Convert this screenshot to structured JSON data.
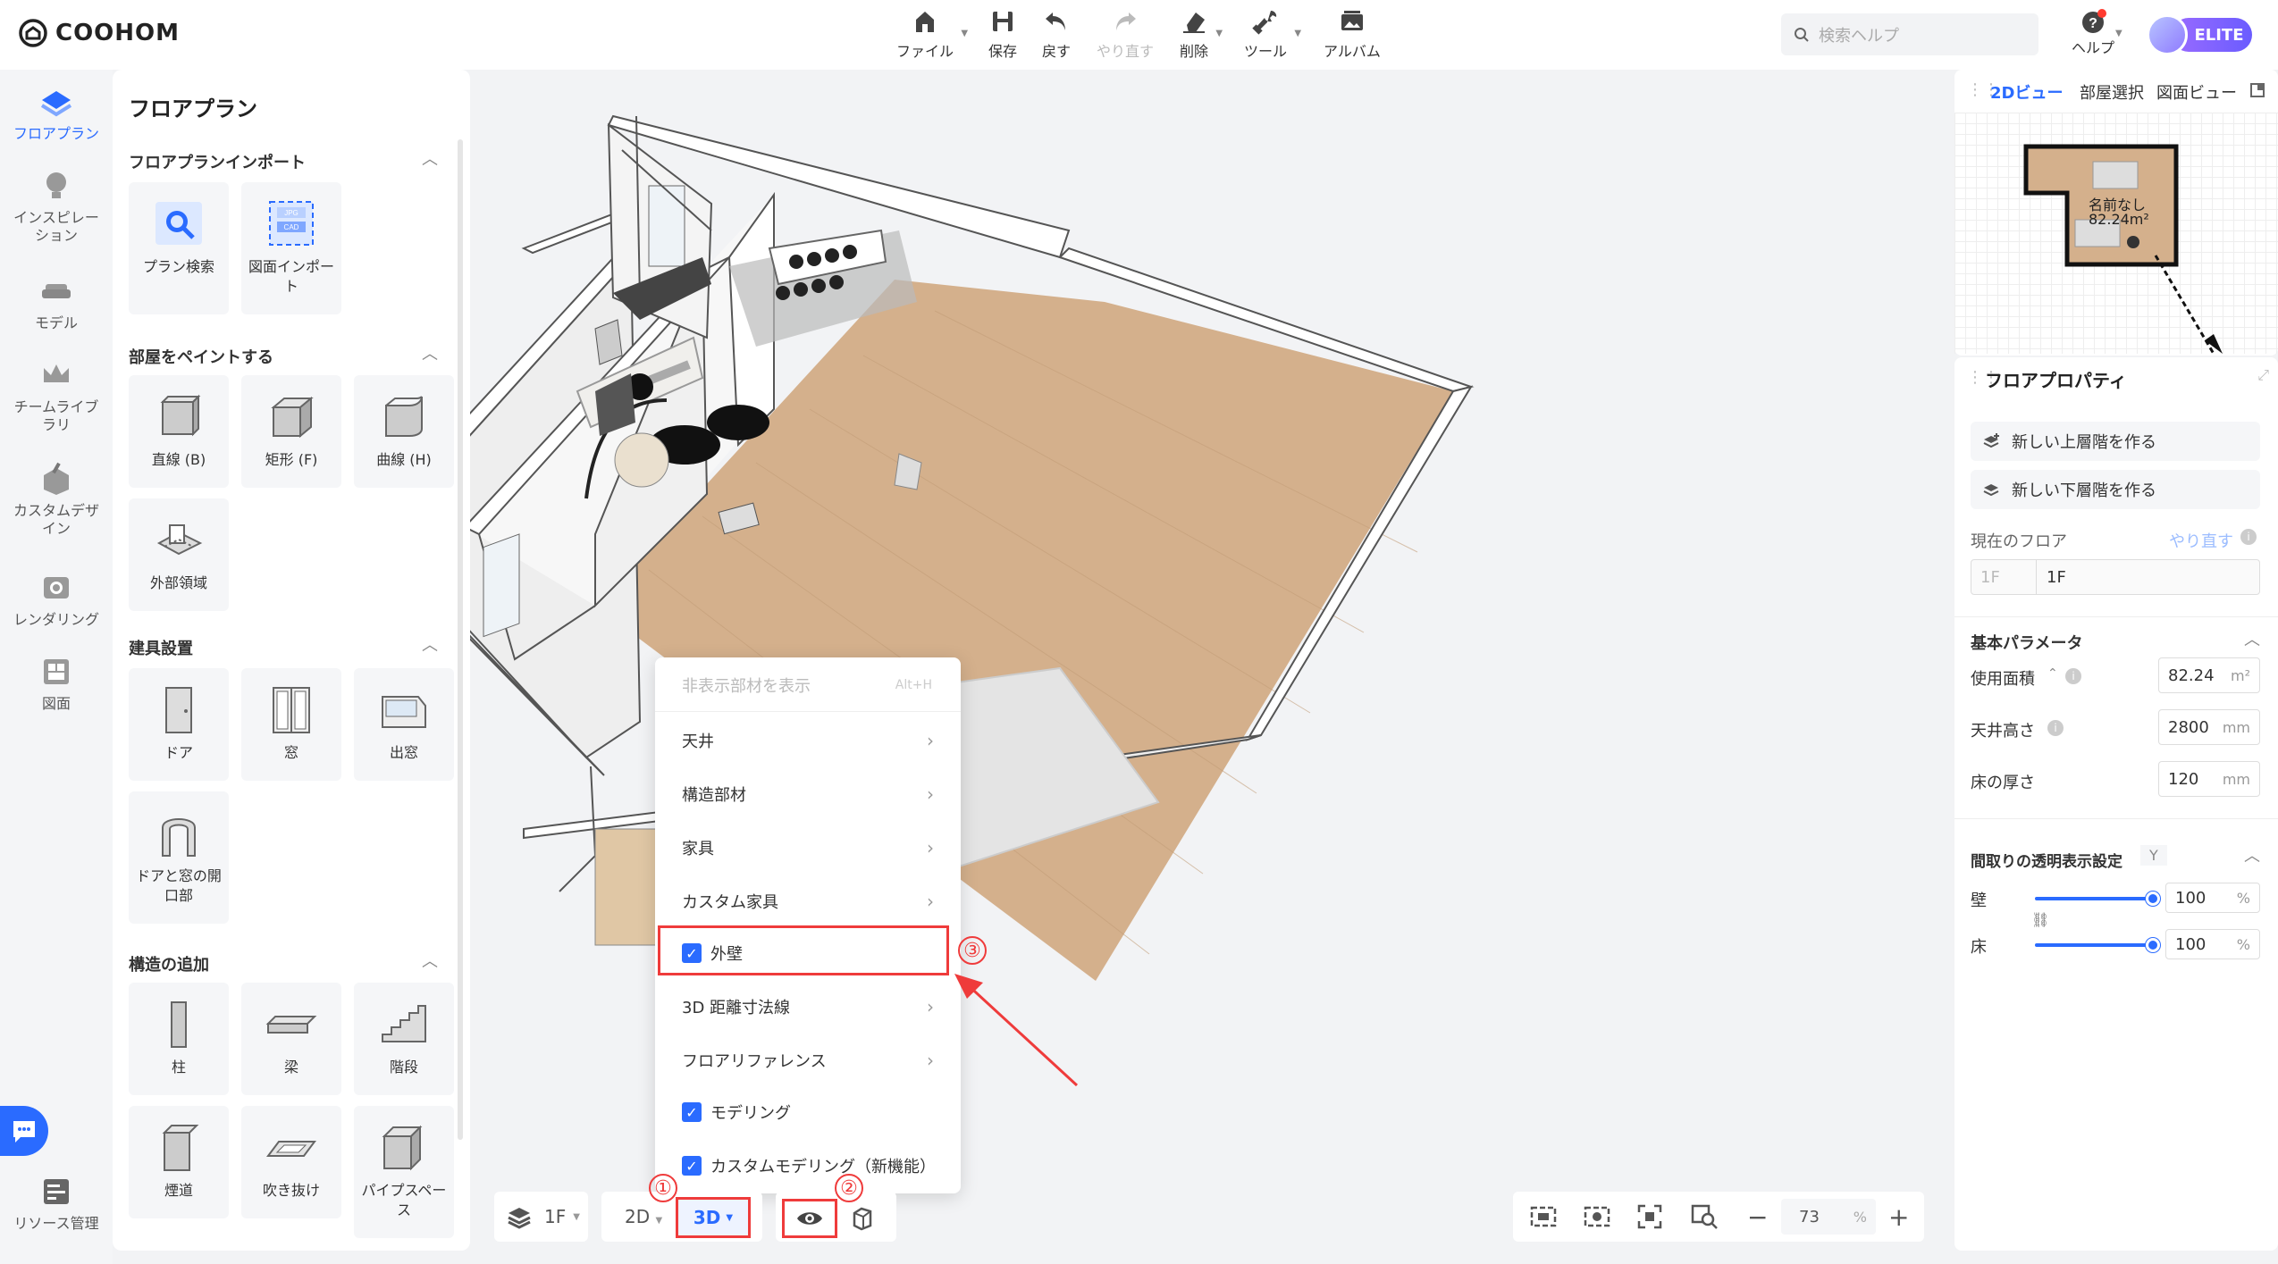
{
  "brand": {
    "name": "COOHOM"
  },
  "toolbar": {
    "file": "ファイル",
    "save": "保存",
    "undo": "戻す",
    "redo": "やり直す",
    "delete": "削除",
    "tools": "ツール",
    "album": "アルバム"
  },
  "search": {
    "placeholder": "検索ヘルプ"
  },
  "help": {
    "label": "ヘルプ"
  },
  "badge": {
    "label": "ELITE"
  },
  "nav": {
    "items": [
      {
        "label": "フロアプラン"
      },
      {
        "label": "インスピレーション"
      },
      {
        "label": "モデル"
      },
      {
        "label": "チームライブラリ"
      },
      {
        "label": "カスタムデザイン"
      },
      {
        "label": "レンダリング"
      },
      {
        "label": "図面"
      },
      {
        "label": "リソース管理"
      }
    ]
  },
  "panel": {
    "title": "フロアプラン",
    "sections": [
      {
        "title": "フロアプランインポート",
        "cards": [
          "プラン検索",
          "図面インポート"
        ]
      },
      {
        "title": "部屋をペイントする",
        "cards": [
          "直線 (B)",
          "矩形 (F)",
          "曲線 (H)",
          "外部領域"
        ]
      },
      {
        "title": "建具設置",
        "cards": [
          "ドア",
          "窓",
          "出窓",
          "ドアと窓の開口部"
        ]
      },
      {
        "title": "構造の追加",
        "cards": [
          "柱",
          "梁",
          "階段",
          "煙道",
          "吹き抜け",
          "パイプスペース"
        ]
      }
    ]
  },
  "menu": {
    "header": "非表示部材を表示",
    "shortcut": "Alt+H",
    "items": [
      {
        "label": "天井"
      },
      {
        "label": "構造部材"
      },
      {
        "label": "家具"
      },
      {
        "label": "カスタム家具"
      },
      {
        "label": "外壁"
      },
      {
        "label": "3D 距離寸法線"
      },
      {
        "label": "フロアリファレンス"
      },
      {
        "label": "モデリング"
      },
      {
        "label": "カスタムモデリング（新機能）"
      }
    ]
  },
  "annotations": {
    "n1": "①",
    "n2": "②",
    "n3": "③"
  },
  "bottombar": {
    "floor": "1F",
    "mode2d": "2D",
    "mode3d": "3D",
    "zoom": "73",
    "zoom_unit": "%"
  },
  "right": {
    "tabs": [
      "2Dビュー",
      "部屋選択",
      "図面ビュー"
    ],
    "minimap": {
      "room_name": "名前なし",
      "room_area": "82.24m²"
    },
    "props_title": "フロアプロパティ",
    "btn_upper": "新しい上層階を作る",
    "btn_lower": "新しい下層階を作る",
    "current_floor": "現在のフロア",
    "redo_link": "やり直す",
    "floor_prefix": "1F",
    "floor_value": "1F",
    "basic": "基本パラメータ",
    "area_label": "使用面積",
    "area_value": "82.24",
    "area_unit": "m²",
    "ceiling_label": "天井高さ",
    "ceiling_value": "2800",
    "ceiling_unit": "mm",
    "floor_label": "床の厚さ",
    "floor_thick": "120",
    "floor_unit": "mm",
    "transparency": "間取りの透明表示設定",
    "transparency_key": "Y",
    "wall_label": "壁",
    "wall_value": "100",
    "wall_unit": "%",
    "floor2_label": "床",
    "floor2_value": "100",
    "floor2_unit": "%"
  }
}
